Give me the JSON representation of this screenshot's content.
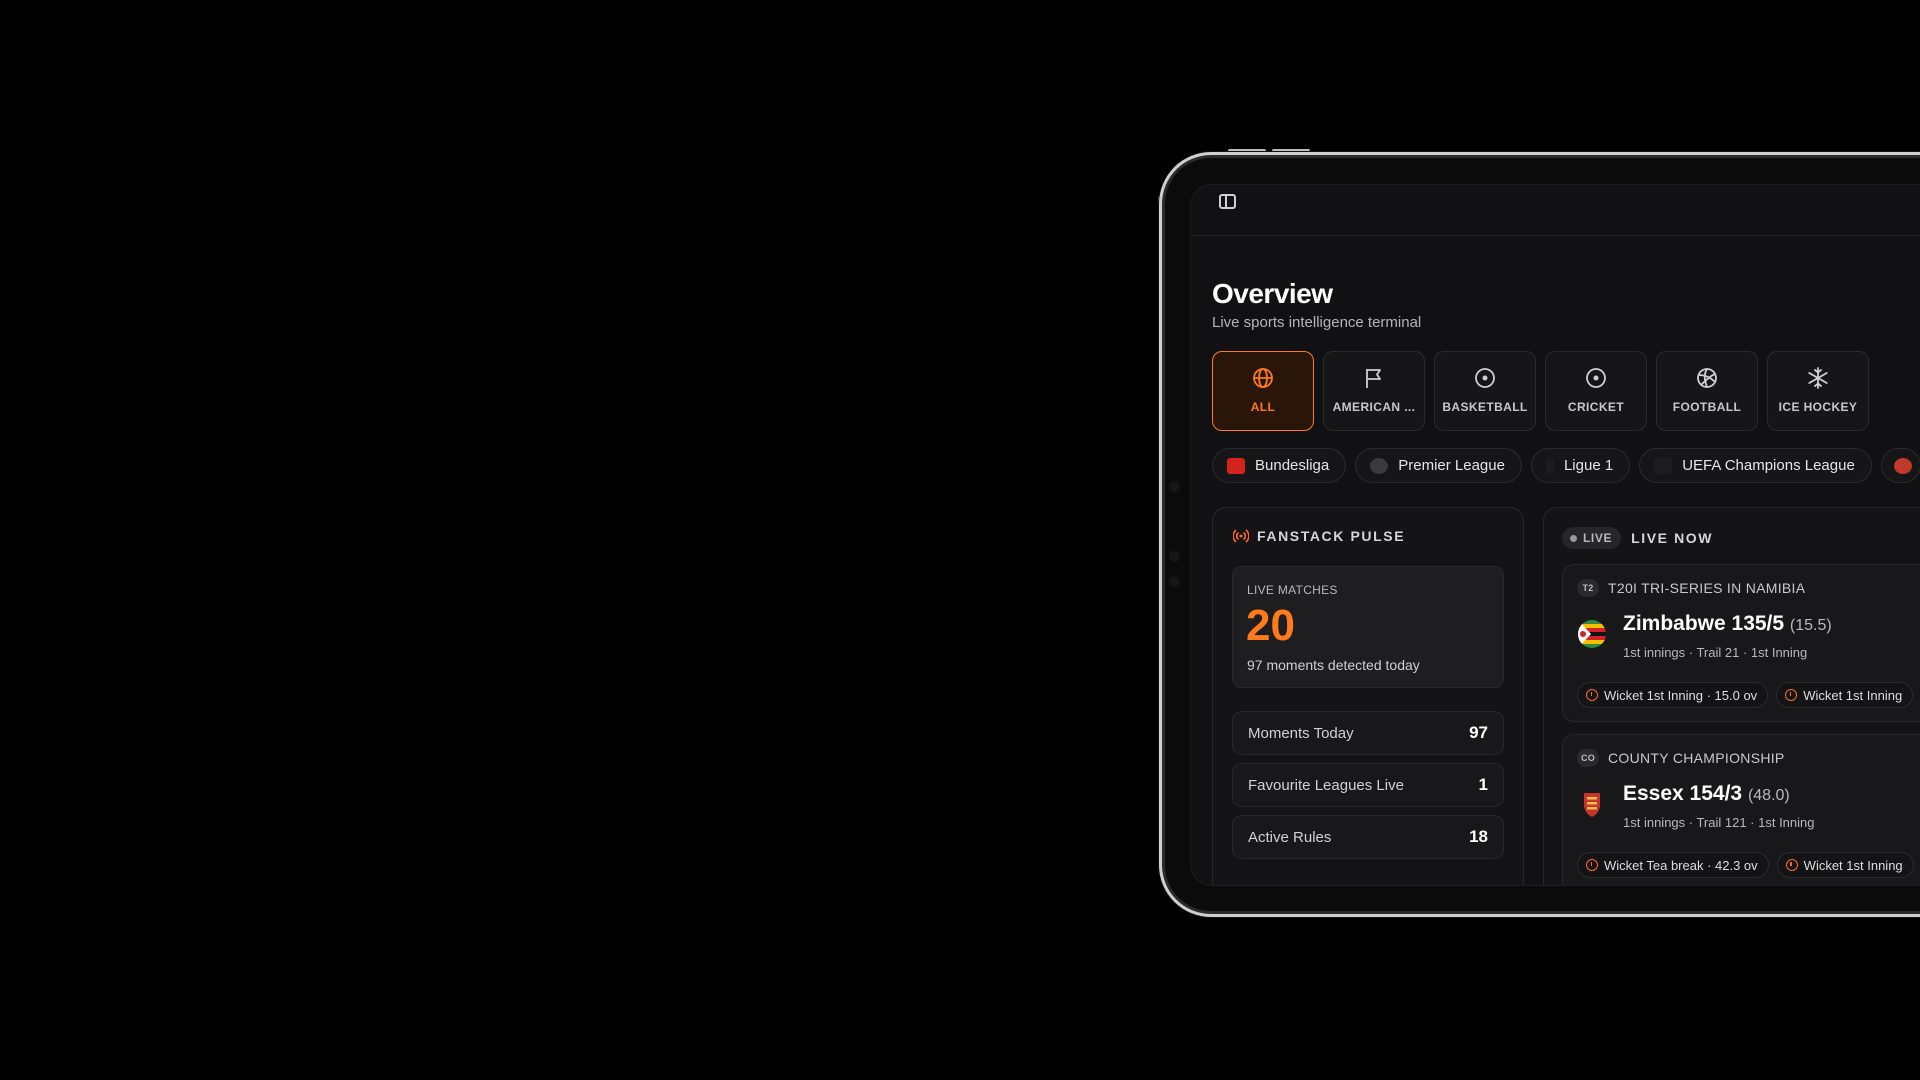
{
  "app": {
    "page_title": "Overview",
    "page_subtitle": "Live sports intelligence terminal"
  },
  "sports": [
    {
      "label": "ALL",
      "icon": "globe-icon",
      "active": true
    },
    {
      "label": "AMERICAN ...",
      "icon": "flag-icon",
      "active": false
    },
    {
      "label": "BASKETBALL",
      "icon": "basketball-icon",
      "active": false
    },
    {
      "label": "CRICKET",
      "icon": "cricket-ball-icon",
      "active": false
    },
    {
      "label": "FOOTBALL",
      "icon": "volleyball-icon",
      "active": false
    },
    {
      "label": "ICE HOCKEY",
      "icon": "snowflake-icon",
      "active": false
    }
  ],
  "leagues": [
    {
      "label": "Bundesliga"
    },
    {
      "label": "Premier League"
    },
    {
      "label": "Ligue 1"
    },
    {
      "label": "UEFA Champions League"
    }
  ],
  "pulse": {
    "title": "FANSTACK PULSE",
    "live_matches_label": "LIVE MATCHES",
    "live_matches_value": "20",
    "moments_detected": "97 moments detected today",
    "stats": [
      {
        "label": "Moments Today",
        "value": "97"
      },
      {
        "label": "Favourite Leagues Live",
        "value": "1"
      },
      {
        "label": "Active Rules",
        "value": "18"
      }
    ]
  },
  "live_now": {
    "badge": "LIVE",
    "title": "LIVE NOW",
    "matches": [
      {
        "tag": "T2",
        "competition": "T20I TRI-SERIES IN NAMIBIA",
        "team_score": "Zimbabwe 135/5",
        "overs": "(15.5)",
        "meta": "1st innings · Trail 21 · 1st Inning",
        "events": [
          "Wicket 1st Inning · 15.0 ov",
          "Wicket 1st Inning"
        ]
      },
      {
        "tag": "CO",
        "competition": "COUNTY CHAMPIONSHIP",
        "team_score": "Essex 154/3",
        "overs": "(48.0)",
        "meta": "1st innings · Trail 121 · 1st Inning",
        "events": [
          "Wicket Tea break · 42.3 ov",
          "Wicket 1st Inning"
        ]
      }
    ]
  },
  "colors": {
    "accent": "#ff7a1a",
    "background": "#000000",
    "surface": "#141416"
  }
}
